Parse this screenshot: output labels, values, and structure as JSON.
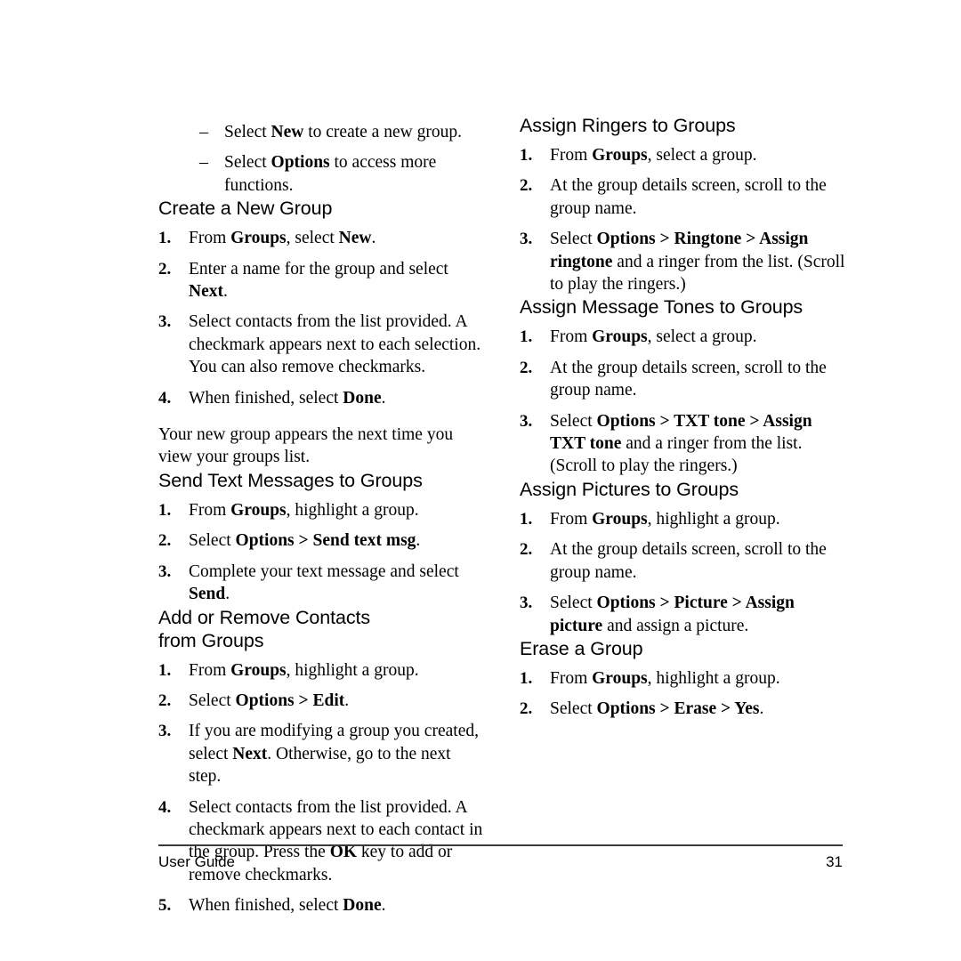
{
  "document": {
    "footer": {
      "label": "User Guide",
      "page_number": "31"
    }
  },
  "left_column": {
    "intro_bullets": {
      "marker": "–",
      "items": [
        {
          "prefix": "Select ",
          "bold": "New",
          "suffix": " to create a new group."
        },
        {
          "prefix": "Select ",
          "bold": "Options",
          "suffix": " to access more functions."
        }
      ]
    },
    "sections": [
      {
        "heading": "Create a New Group",
        "steps": [
          {
            "marker": "1.",
            "parts": [
              {
                "t": "From ",
                "b": false
              },
              {
                "t": "Groups",
                "b": true
              },
              {
                "t": ", select ",
                "b": false
              },
              {
                "t": "New",
                "b": true
              },
              {
                "t": ".",
                "b": false
              }
            ]
          },
          {
            "marker": "2.",
            "parts": [
              {
                "t": "Enter a name for the group and select ",
                "b": false
              },
              {
                "t": "Next",
                "b": true
              },
              {
                "t": ".",
                "b": false
              }
            ]
          },
          {
            "marker": "3.",
            "parts": [
              {
                "t": "Select contacts from the list provided. A checkmark appears next to each selection. You can also remove checkmarks.",
                "b": false
              }
            ]
          },
          {
            "marker": "4.",
            "parts": [
              {
                "t": "When finished, select ",
                "b": false
              },
              {
                "t": "Done",
                "b": true
              },
              {
                "t": ".",
                "b": false
              }
            ]
          }
        ],
        "note": "Your new group appears the next time you view your groups list."
      },
      {
        "heading": "Send Text Messages to Groups",
        "steps": [
          {
            "marker": "1.",
            "parts": [
              {
                "t": "From ",
                "b": false
              },
              {
                "t": "Groups",
                "b": true
              },
              {
                "t": ", highlight a group.",
                "b": false
              }
            ]
          },
          {
            "marker": "2.",
            "parts": [
              {
                "t": "Select ",
                "b": false
              },
              {
                "t": "Options > Send text msg",
                "b": true
              },
              {
                "t": ".",
                "b": false
              }
            ]
          },
          {
            "marker": "3.",
            "parts": [
              {
                "t": "Complete your text message and select ",
                "b": false
              },
              {
                "t": "Send",
                "b": true
              },
              {
                "t": ".",
                "b": false
              }
            ]
          }
        ]
      },
      {
        "heading": "Add or Remove Contacts\nfrom Groups",
        "steps": [
          {
            "marker": "1.",
            "parts": [
              {
                "t": "From ",
                "b": false
              },
              {
                "t": "Groups",
                "b": true
              },
              {
                "t": ", highlight a group.",
                "b": false
              }
            ]
          },
          {
            "marker": "2.",
            "parts": [
              {
                "t": "Select ",
                "b": false
              },
              {
                "t": "Options > Edit",
                "b": true
              },
              {
                "t": ".",
                "b": false
              }
            ]
          },
          {
            "marker": "3.",
            "parts": [
              {
                "t": "If you are modifying a group you created, select ",
                "b": false
              },
              {
                "t": "Next",
                "b": true
              },
              {
                "t": ". Otherwise, go to the next step.",
                "b": false
              }
            ]
          },
          {
            "marker": "4.",
            "parts": [
              {
                "t": "Select contacts from the list provided. A checkmark appears next to each contact in the group. Press the ",
                "b": false
              },
              {
                "t": "OK",
                "b": true
              },
              {
                "t": " key to add or remove checkmarks.",
                "b": false
              }
            ]
          },
          {
            "marker": "5.",
            "parts": [
              {
                "t": "When finished, select ",
                "b": false
              },
              {
                "t": "Done",
                "b": true
              },
              {
                "t": ".",
                "b": false
              }
            ]
          }
        ]
      }
    ]
  },
  "right_column": {
    "sections": [
      {
        "heading": "Assign Ringers to Groups",
        "steps": [
          {
            "marker": "1.",
            "parts": [
              {
                "t": "From ",
                "b": false
              },
              {
                "t": "Groups",
                "b": true
              },
              {
                "t": ", select a group.",
                "b": false
              }
            ]
          },
          {
            "marker": "2.",
            "parts": [
              {
                "t": "At the group details screen, scroll to the group name.",
                "b": false
              }
            ]
          },
          {
            "marker": "3.",
            "parts": [
              {
                "t": "Select ",
                "b": false
              },
              {
                "t": "Options > Ringtone > Assign ringtone",
                "b": true
              },
              {
                "t": " and a ringer from the list. (Scroll to play the ringers.)",
                "b": false
              }
            ]
          }
        ]
      },
      {
        "heading": "Assign Message Tones to Groups",
        "steps": [
          {
            "marker": "1.",
            "parts": [
              {
                "t": "From ",
                "b": false
              },
              {
                "t": "Groups",
                "b": true
              },
              {
                "t": ", select a group.",
                "b": false
              }
            ]
          },
          {
            "marker": "2.",
            "parts": [
              {
                "t": "At the group details screen, scroll to the group name.",
                "b": false
              }
            ]
          },
          {
            "marker": "3.",
            "parts": [
              {
                "t": "Select ",
                "b": false
              },
              {
                "t": "Options > TXT tone > Assign TXT tone",
                "b": true
              },
              {
                "t": " and a ringer from the list. (Scroll to play the ringers.)",
                "b": false
              }
            ]
          }
        ]
      },
      {
        "heading": "Assign Pictures to Groups",
        "steps": [
          {
            "marker": "1.",
            "parts": [
              {
                "t": "From ",
                "b": false
              },
              {
                "t": "Groups",
                "b": true
              },
              {
                "t": ", highlight a group.",
                "b": false
              }
            ]
          },
          {
            "marker": "2.",
            "parts": [
              {
                "t": "At the group details screen, scroll to the group name.",
                "b": false
              }
            ]
          },
          {
            "marker": "3.",
            "parts": [
              {
                "t": "Select ",
                "b": false
              },
              {
                "t": "Options > Picture > Assign picture",
                "b": true
              },
              {
                "t": " and assign a picture.",
                "b": false
              }
            ]
          }
        ]
      },
      {
        "heading": "Erase a Group",
        "steps": [
          {
            "marker": "1.",
            "parts": [
              {
                "t": "From ",
                "b": false
              },
              {
                "t": "Groups",
                "b": true
              },
              {
                "t": ", highlight a group.",
                "b": false
              }
            ]
          },
          {
            "marker": "2.",
            "parts": [
              {
                "t": "Select ",
                "b": false
              },
              {
                "t": "Options > Erase > Yes",
                "b": true
              },
              {
                "t": ".",
                "b": false
              }
            ]
          }
        ]
      }
    ]
  }
}
